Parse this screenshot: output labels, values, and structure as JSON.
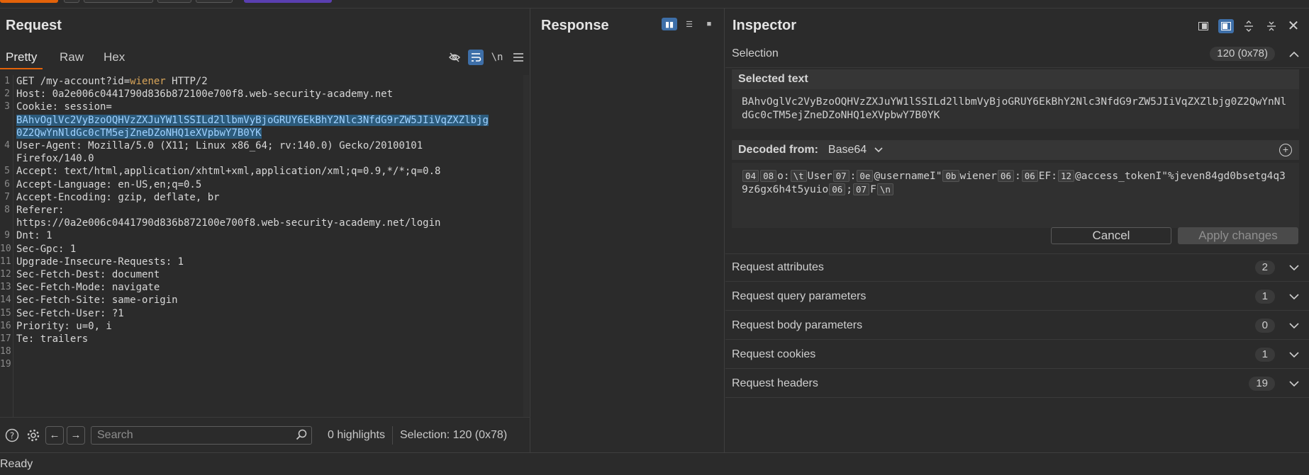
{
  "request": {
    "title": "Request",
    "tabs": [
      "Pretty",
      "Raw",
      "Hex"
    ],
    "active_tab": "Pretty",
    "newline_label": "\\n",
    "lines": [
      {
        "n": "1",
        "segments": [
          {
            "t": "GET /my-account?id=",
            "c": "code"
          },
          {
            "t": "wiener",
            "c": "param"
          },
          {
            "t": " HTTP/2",
            "c": "code"
          }
        ]
      },
      {
        "n": "2",
        "segments": [
          {
            "t": "Host: 0a2e006c0441790d836b872100e700f8.web-security-academy.net",
            "c": "code"
          }
        ]
      },
      {
        "n": "3",
        "segments": [
          {
            "t": "Cookie: session=",
            "c": "code"
          }
        ]
      },
      {
        "n": "",
        "segments": [
          {
            "t": "BAhvOglVc2VyBzoOQHVzZXJuYW1lSSILd2llbmVyBjoGRUY6EkBhY2Nlc3NfdG9rZW5JIiVqZXZlbjg",
            "c": "sel"
          }
        ]
      },
      {
        "n": "",
        "segments": [
          {
            "t": "0Z2QwYnNldGc0cTM5ejZneDZoNHQ1eXVpbwY7B0YK",
            "c": "sel"
          }
        ]
      },
      {
        "n": "4",
        "segments": [
          {
            "t": "User-Agent: Mozilla/5.0 (X11; Linux x86_64; rv:140.0) Gecko/20100101",
            "c": "code"
          }
        ]
      },
      {
        "n": "",
        "segments": [
          {
            "t": "Firefox/140.0",
            "c": "code"
          }
        ]
      },
      {
        "n": "5",
        "segments": [
          {
            "t": "Accept: text/html,application/xhtml+xml,application/xml;q=0.9,*/*;q=0.8",
            "c": "code"
          }
        ]
      },
      {
        "n": "6",
        "segments": [
          {
            "t": "Accept-Language: en-US,en;q=0.5",
            "c": "code"
          }
        ]
      },
      {
        "n": "7",
        "segments": [
          {
            "t": "Accept-Encoding: gzip, deflate, br",
            "c": "code"
          }
        ]
      },
      {
        "n": "8",
        "segments": [
          {
            "t": "Referer:",
            "c": "code"
          }
        ]
      },
      {
        "n": "",
        "segments": [
          {
            "t": "https://0a2e006c0441790d836b872100e700f8.web-security-academy.net/login",
            "c": "code"
          }
        ]
      },
      {
        "n": "9",
        "segments": [
          {
            "t": "Dnt: 1",
            "c": "code"
          }
        ]
      },
      {
        "n": "10",
        "segments": [
          {
            "t": "Sec-Gpc: 1",
            "c": "code"
          }
        ]
      },
      {
        "n": "11",
        "segments": [
          {
            "t": "Upgrade-Insecure-Requests: 1",
            "c": "code"
          }
        ]
      },
      {
        "n": "12",
        "segments": [
          {
            "t": "Sec-Fetch-Dest: document",
            "c": "code"
          }
        ]
      },
      {
        "n": "13",
        "segments": [
          {
            "t": "Sec-Fetch-Mode: navigate",
            "c": "code"
          }
        ]
      },
      {
        "n": "14",
        "segments": [
          {
            "t": "Sec-Fetch-Site: same-origin",
            "c": "code"
          }
        ]
      },
      {
        "n": "15",
        "segments": [
          {
            "t": "Sec-Fetch-User: ?1",
            "c": "code"
          }
        ]
      },
      {
        "n": "16",
        "segments": [
          {
            "t": "Priority: u=0, i",
            "c": "code"
          }
        ]
      },
      {
        "n": "17",
        "segments": [
          {
            "t": "Te: trailers",
            "c": "code"
          }
        ]
      },
      {
        "n": "18",
        "segments": []
      },
      {
        "n": "19",
        "segments": []
      }
    ],
    "search": {
      "placeholder": "Search",
      "value": ""
    },
    "highlights": "0 highlights",
    "selection": "Selection: 120 (0x78)"
  },
  "response": {
    "title": "Response"
  },
  "inspector": {
    "title": "Inspector",
    "selection_label": "Selection",
    "selection_badge": "120 (0x78)",
    "selected_text_label": "Selected text",
    "selected_text": "BAhvOglVc2VyBzoOQHVzZXJuYW1lSSILd2llbmVyBjoGRUY6EkBhY2Nlc3NfdG9rZW5JIiVqZXZlbjg0Z2QwYnNldGc0cTM5ejZneDZoNHQ1eXVpbwY7B0YK",
    "decoded_from_label": "Decoded from:",
    "encoding": "Base64",
    "decoded_parts": [
      {
        "hex": "04"
      },
      {
        "hex": "08"
      },
      {
        "t": "o:"
      },
      {
        "hex": "\\t"
      },
      {
        "t": "User"
      },
      {
        "hex": "07"
      },
      {
        "t": ":"
      },
      {
        "hex": "0e"
      },
      {
        "t": "@usernameI\""
      },
      {
        "hex": "0b"
      },
      {
        "t": "wiener"
      },
      {
        "hex": "06"
      },
      {
        "t": ":"
      },
      {
        "hex": "06"
      },
      {
        "t": "EF:"
      },
      {
        "hex": "12"
      },
      {
        "t": "@access_tokenI\"%jeven84gd0bsetg4q39z6gx6h4t5yuio"
      },
      {
        "hex": "06"
      },
      {
        "t": ";"
      },
      {
        "hex": "07"
      },
      {
        "t": "F"
      },
      {
        "hex": "\\n"
      }
    ],
    "cancel_label": "Cancel",
    "apply_label": "Apply changes",
    "sections": [
      {
        "label": "Request attributes",
        "count": "2"
      },
      {
        "label": "Request query parameters",
        "count": "1"
      },
      {
        "label": "Request body parameters",
        "count": "0"
      },
      {
        "label": "Request cookies",
        "count": "1"
      },
      {
        "label": "Request headers",
        "count": "19"
      }
    ]
  },
  "status": "Ready",
  "colors": {
    "accent": "#e36209",
    "toggle_on": "#3e6fa8",
    "selection_bg": "#2c5b7c",
    "param": "#d8a55a"
  }
}
